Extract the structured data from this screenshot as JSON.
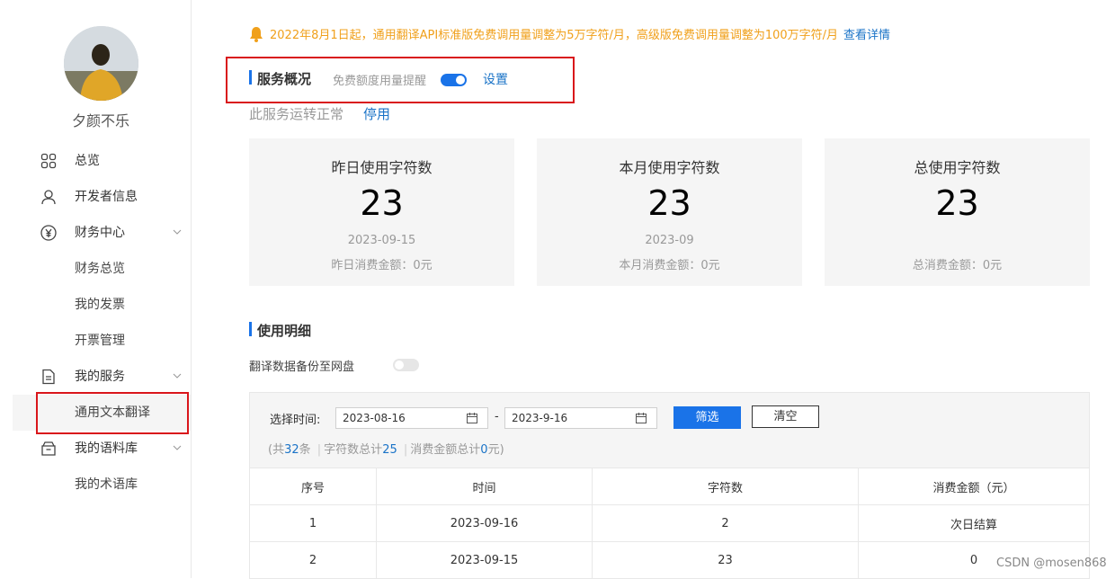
{
  "sidebar": {
    "username": "夕颜不乐",
    "items": [
      {
        "label": "总览",
        "icon": "grid-icon"
      },
      {
        "label": "开发者信息",
        "icon": "user-icon"
      },
      {
        "label": "财务中心",
        "icon": "yen-icon"
      },
      {
        "label": "财务总览"
      },
      {
        "label": "我的发票"
      },
      {
        "label": "开票管理"
      },
      {
        "label": "我的服务",
        "icon": "document-icon"
      },
      {
        "label": "通用文本翻译"
      },
      {
        "label": "我的语料库",
        "icon": "box-icon"
      },
      {
        "label": "我的术语库"
      }
    ]
  },
  "notice": {
    "text": "2022年8月1日起，通用翻译API标准版免费调用量调整为5万字符/月，高级版免费调用量调整为100万字符/月",
    "link": "查看详情"
  },
  "overview": {
    "title": "服务概况",
    "reminder_label": "免费额度用量提醒",
    "reminder_on": true,
    "settings_link": "设置",
    "status_text": "此服务运转正常",
    "disable_link": "停用"
  },
  "cards": [
    {
      "title": "昨日使用字符数",
      "count": "23",
      "date": "2023-09-15",
      "cost": "昨日消费金额：0元"
    },
    {
      "title": "本月使用字符数",
      "count": "23",
      "date": "2023-09",
      "cost": "本月消费金额：0元"
    },
    {
      "title": "总使用字符数",
      "count": "23",
      "date": "",
      "cost": "总消费金额：0元"
    }
  ],
  "usage": {
    "title": "使用明细",
    "backup_label": "翻译数据备份至网盘",
    "backup_on": false,
    "filter": {
      "label": "选择时间:",
      "start": "2023-08-16",
      "sep": "-",
      "end": "2023-9-16",
      "filter_btn": "筛选",
      "clear_btn": "清空"
    },
    "summary": {
      "prefix": "(共",
      "total": "32",
      "unit": "条",
      "chars_label": "字符数总计",
      "chars": "25",
      "cost_label": "消费金额总计",
      "cost": "0",
      "suffix": "元)"
    },
    "columns": [
      "序号",
      "时间",
      "字符数",
      "消费金额（元）"
    ],
    "rows": [
      [
        "1",
        "2023-09-16",
        "2",
        "次日结算"
      ],
      [
        "2",
        "2023-09-15",
        "23",
        "0"
      ]
    ]
  },
  "watermark": "CSDN @mosen868",
  "colors": {
    "accent": "#1a73e8",
    "notice": "#f0a01b",
    "highlight": "#d9161b"
  }
}
